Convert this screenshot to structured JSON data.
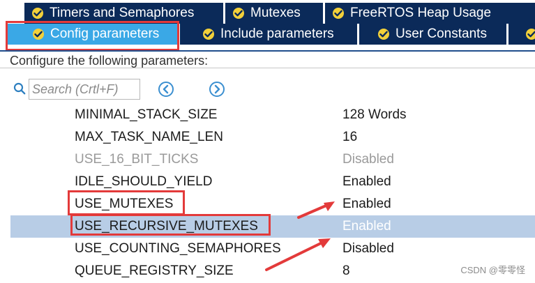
{
  "tabs": {
    "row1": [
      {
        "label": "Timers and Semaphores",
        "icon": "check-circle-icon"
      },
      {
        "label": "Mutexes",
        "icon": "check-circle-icon"
      },
      {
        "label": "FreeRTOS Heap Usage",
        "icon": "check-circle-icon"
      }
    ],
    "row2": [
      {
        "label": "Config parameters",
        "icon": "check-circle-icon",
        "active": true
      },
      {
        "label": "Include parameters",
        "icon": "check-circle-icon"
      },
      {
        "label": "User Constants",
        "icon": "check-circle-icon"
      }
    ]
  },
  "header": {
    "text": "Configure the following parameters:"
  },
  "search": {
    "placeholder": "Search (Crtl+F)"
  },
  "parameters": [
    {
      "name": "MINIMAL_STACK_SIZE",
      "value": "128 Words",
      "state": "normal"
    },
    {
      "name": "MAX_TASK_NAME_LEN",
      "value": "16",
      "state": "normal"
    },
    {
      "name": "USE_16_BIT_TICKS",
      "value": "Disabled",
      "state": "disabled"
    },
    {
      "name": "IDLE_SHOULD_YIELD",
      "value": "Enabled",
      "state": "normal"
    },
    {
      "name": "USE_MUTEXES",
      "value": "Enabled",
      "state": "normal"
    },
    {
      "name": "USE_RECURSIVE_MUTEXES",
      "value": "Enabled",
      "state": "selected"
    },
    {
      "name": "USE_COUNTING_SEMAPHORES",
      "value": "Disabled",
      "state": "normal"
    },
    {
      "name": "QUEUE_REGISTRY_SIZE",
      "value": "8",
      "state": "normal"
    }
  ],
  "watermark": "CSDN @零零怪",
  "colors": {
    "tab_bg": "#0b2a59",
    "tab_active_bg": "#3aa8e6",
    "check_fill": "#f2d03a",
    "annotation_red": "#e33a3a",
    "selected_row": "#b8cde6",
    "nav_blue": "#3b8fd0"
  }
}
